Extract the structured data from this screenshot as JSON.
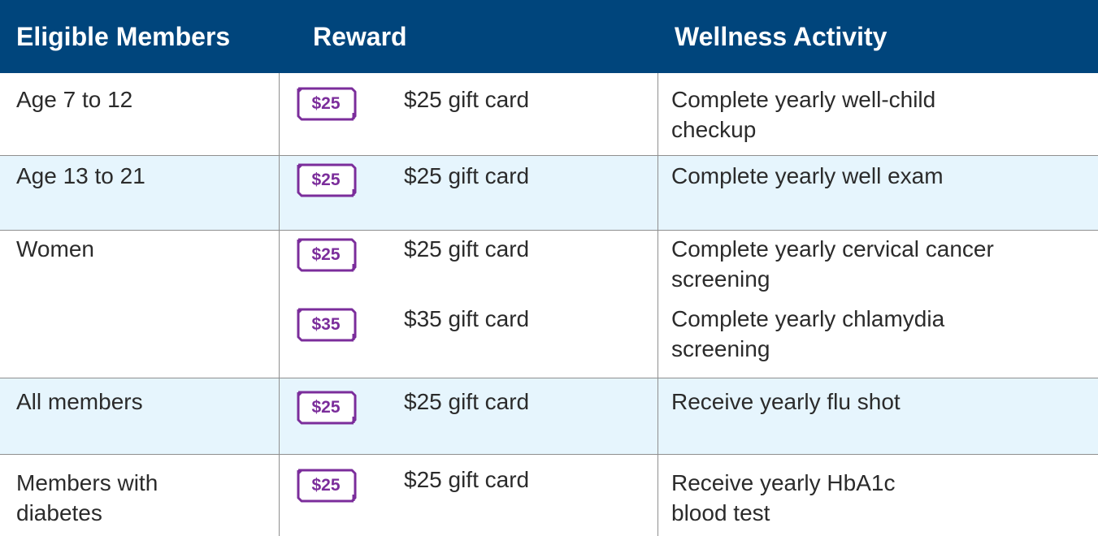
{
  "header": {
    "eligible_label": "Eligible Members",
    "reward_label": "Reward",
    "activity_label": "Wellness Activity"
  },
  "rows": [
    {
      "eligible": "Age 7 to 12",
      "rewards": [
        {
          "badge": "$25",
          "text": "$25 gift card",
          "activity": "Complete yearly well-child checkup"
        }
      ]
    },
    {
      "eligible": "Age 13 to 21",
      "rewards": [
        {
          "badge": "$25",
          "text": "$25 gift card",
          "activity": "Complete yearly well exam"
        }
      ]
    },
    {
      "eligible": "Women",
      "rewards": [
        {
          "badge": "$25",
          "text": "$25 gift card",
          "activity": "Complete yearly cervical cancer screening"
        },
        {
          "badge": "$35",
          "text": "$35 gift card",
          "activity": "Complete yearly chlamydia screening"
        }
      ]
    },
    {
      "eligible": "All members",
      "rewards": [
        {
          "badge": "$25",
          "text": "$25 gift card",
          "activity": "Receive yearly flu shot"
        }
      ]
    },
    {
      "eligible": "Members with diabetes",
      "rewards": [
        {
          "badge": "$25",
          "text": "$25 gift card",
          "activity": "Receive yearly HbA1c blood test"
        }
      ]
    }
  ],
  "colors": {
    "header_bg": "#00457c",
    "alt_row_bg": "#e6f5fd",
    "badge_purple": "#7b2d9b"
  },
  "icons": {
    "badge": "gift-card-icon"
  }
}
